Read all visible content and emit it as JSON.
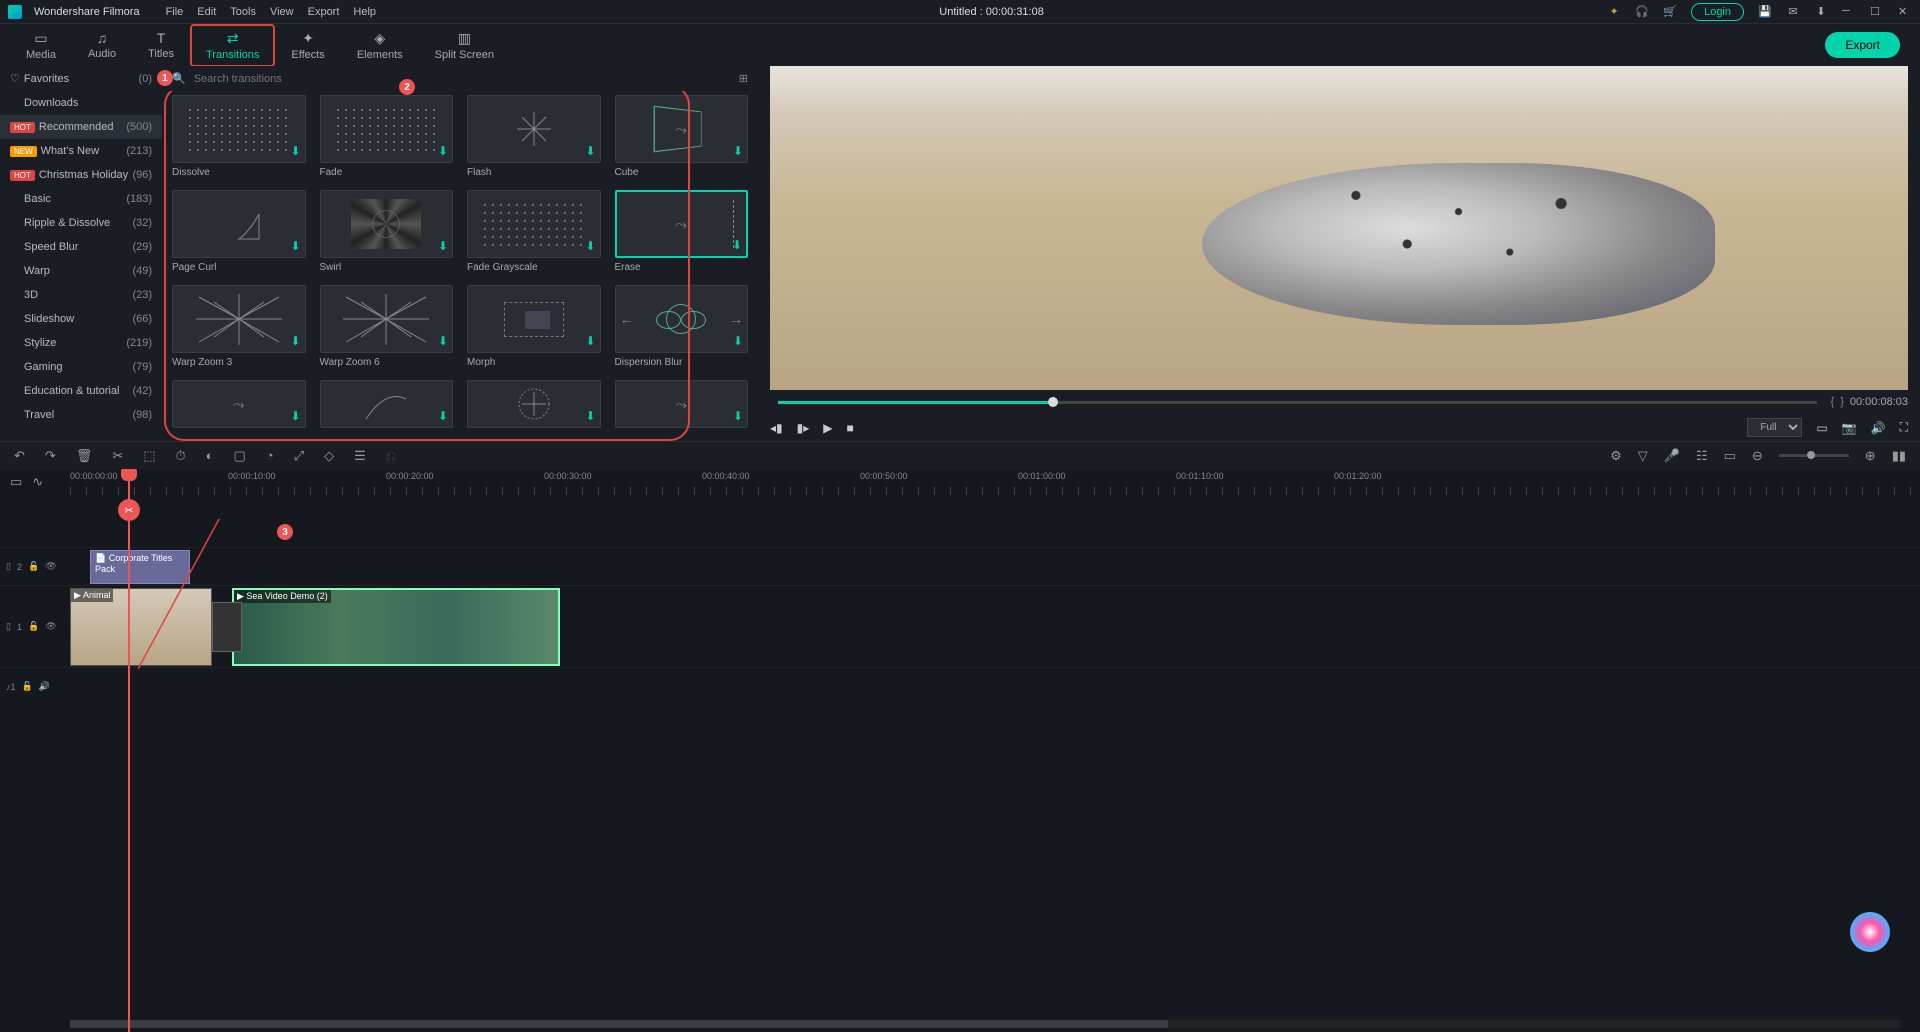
{
  "app": {
    "name": "Wondershare Filmora",
    "title": "Untitled : 00:00:31:08"
  },
  "menu": [
    "File",
    "Edit",
    "Tools",
    "View",
    "Export",
    "Help"
  ],
  "titlebar_right": {
    "login": "Login"
  },
  "tabs": [
    {
      "label": "Media",
      "icon": "▭"
    },
    {
      "label": "Audio",
      "icon": "♫"
    },
    {
      "label": "Titles",
      "icon": "T"
    },
    {
      "label": "Transitions",
      "icon": "⇄",
      "active": true
    },
    {
      "label": "Effects",
      "icon": "✦"
    },
    {
      "label": "Elements",
      "icon": "◈"
    },
    {
      "label": "Split Screen",
      "icon": "▥"
    }
  ],
  "export_btn": "Export",
  "callouts": {
    "c1": "1",
    "c2": "2",
    "c3": "3"
  },
  "sidebar": [
    {
      "label": "Favorites",
      "count": "(0)",
      "icon": "heart"
    },
    {
      "label": "Downloads",
      "count": ""
    },
    {
      "label": "Recommended",
      "count": "(500)",
      "badge": "HOT",
      "selected": true
    },
    {
      "label": "What's New",
      "count": "(213)",
      "badge": "NEW"
    },
    {
      "label": "Christmas Holiday",
      "count": "(96)",
      "badge": "HOT"
    },
    {
      "label": "Basic",
      "count": "(183)"
    },
    {
      "label": "Ripple & Dissolve",
      "count": "(32)"
    },
    {
      "label": "Speed Blur",
      "count": "(29)"
    },
    {
      "label": "Warp",
      "count": "(49)"
    },
    {
      "label": "3D",
      "count": "(23)"
    },
    {
      "label": "Slideshow",
      "count": "(66)"
    },
    {
      "label": "Stylize",
      "count": "(219)"
    },
    {
      "label": "Gaming",
      "count": "(79)"
    },
    {
      "label": "Education & tutorial",
      "count": "(42)"
    },
    {
      "label": "Travel",
      "count": "(98)"
    }
  ],
  "search": {
    "placeholder": "Search transitions"
  },
  "transitions": [
    {
      "label": "Dissolve",
      "thumb": "dots"
    },
    {
      "label": "Fade",
      "thumb": "dots"
    },
    {
      "label": "Flash",
      "thumb": "flash"
    },
    {
      "label": "Cube",
      "thumb": "cube"
    },
    {
      "label": "Page Curl",
      "thumb": "curl"
    },
    {
      "label": "Swirl",
      "thumb": "swirl"
    },
    {
      "label": "Fade Grayscale",
      "thumb": "dots"
    },
    {
      "label": "Erase",
      "thumb": "erase",
      "selected": true
    },
    {
      "label": "Warp Zoom 3",
      "thumb": "burst"
    },
    {
      "label": "Warp Zoom 6",
      "thumb": "burst"
    },
    {
      "label": "Morph",
      "thumb": "morph"
    },
    {
      "label": "Dispersion Blur",
      "thumb": "circles"
    },
    {
      "label": "",
      "thumb": "arrow"
    },
    {
      "label": "",
      "thumb": "arc"
    },
    {
      "label": "",
      "thumb": "target"
    },
    {
      "label": "",
      "thumb": "arrow"
    }
  ],
  "preview": {
    "timecode": "00:00:08:03",
    "quality": "Full"
  },
  "ruler": [
    "00:00:00:00",
    "00:00:10:00",
    "00:00:20:00",
    "00:00:30:00",
    "00:00:40:00",
    "00:00:50:00",
    "00:01:00:00",
    "00:01:10:00",
    "00:01:20:00"
  ],
  "tracks": {
    "t2_label": "2",
    "t1_label": "1",
    "a1_label": "♪1",
    "title_clip": "Corporate Titles Pack",
    "video1": "Animal",
    "video2": "Sea Video Demo (2)"
  }
}
